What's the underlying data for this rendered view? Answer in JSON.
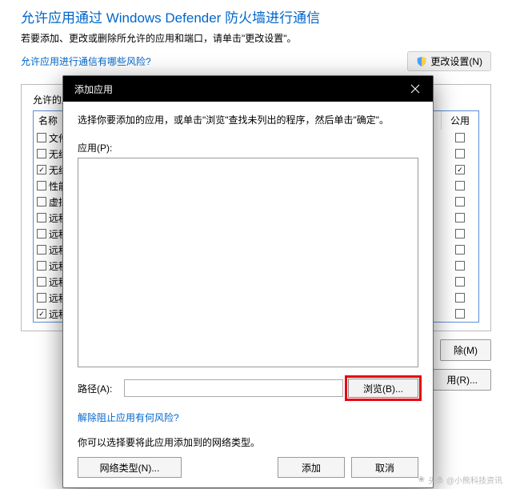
{
  "header": {
    "title": "允许应用通过 Windows Defender 防火墙进行通信",
    "subtitle": "若要添加、更改或删除所允许的应用和端口，请单击\"更改设置\"。",
    "risk_link": "允许应用进行通信有哪些风险?",
    "change_settings": "更改设置(N)"
  },
  "table": {
    "caption": "允许的应",
    "col_name": "名称",
    "col_public": "公用",
    "rows": [
      {
        "name": "文件",
        "name_checked": false,
        "pub_checked": false
      },
      {
        "name": "无线",
        "name_checked": false,
        "pub_checked": false
      },
      {
        "name": "无线",
        "name_checked": true,
        "pub_checked": true
      },
      {
        "name": "性能",
        "name_checked": false,
        "pub_checked": false
      },
      {
        "name": "虚拟",
        "name_checked": false,
        "pub_checked": false
      },
      {
        "name": "远程",
        "name_checked": false,
        "pub_checked": false
      },
      {
        "name": "远程",
        "name_checked": false,
        "pub_checked": false
      },
      {
        "name": "远程",
        "name_checked": false,
        "pub_checked": false
      },
      {
        "name": "远程",
        "name_checked": false,
        "pub_checked": false
      },
      {
        "name": "远程",
        "name_checked": false,
        "pub_checked": false
      },
      {
        "name": "远程",
        "name_checked": false,
        "pub_checked": false
      },
      {
        "name": "远程",
        "name_checked": true,
        "pub_checked": false
      }
    ]
  },
  "buttons": {
    "remove": "除(M)",
    "allow_other": "用(R)..."
  },
  "modal": {
    "title": "添加应用",
    "instruction": "选择你要添加的应用，或单击\"浏览\"查找未列出的程序，然后单击\"确定\"。",
    "apps_label": "应用(P):",
    "path_label": "路径(A):",
    "path_value": "",
    "browse": "浏览(B)...",
    "unblock_link": "解除阻止应用有何风险?",
    "nettype_text": "你可以选择要将此应用添加到的网络类型。",
    "nettype_btn": "网络类型(N)...",
    "add": "添加",
    "cancel": "取消"
  },
  "watermark": "头条 @小熊科技资讯"
}
